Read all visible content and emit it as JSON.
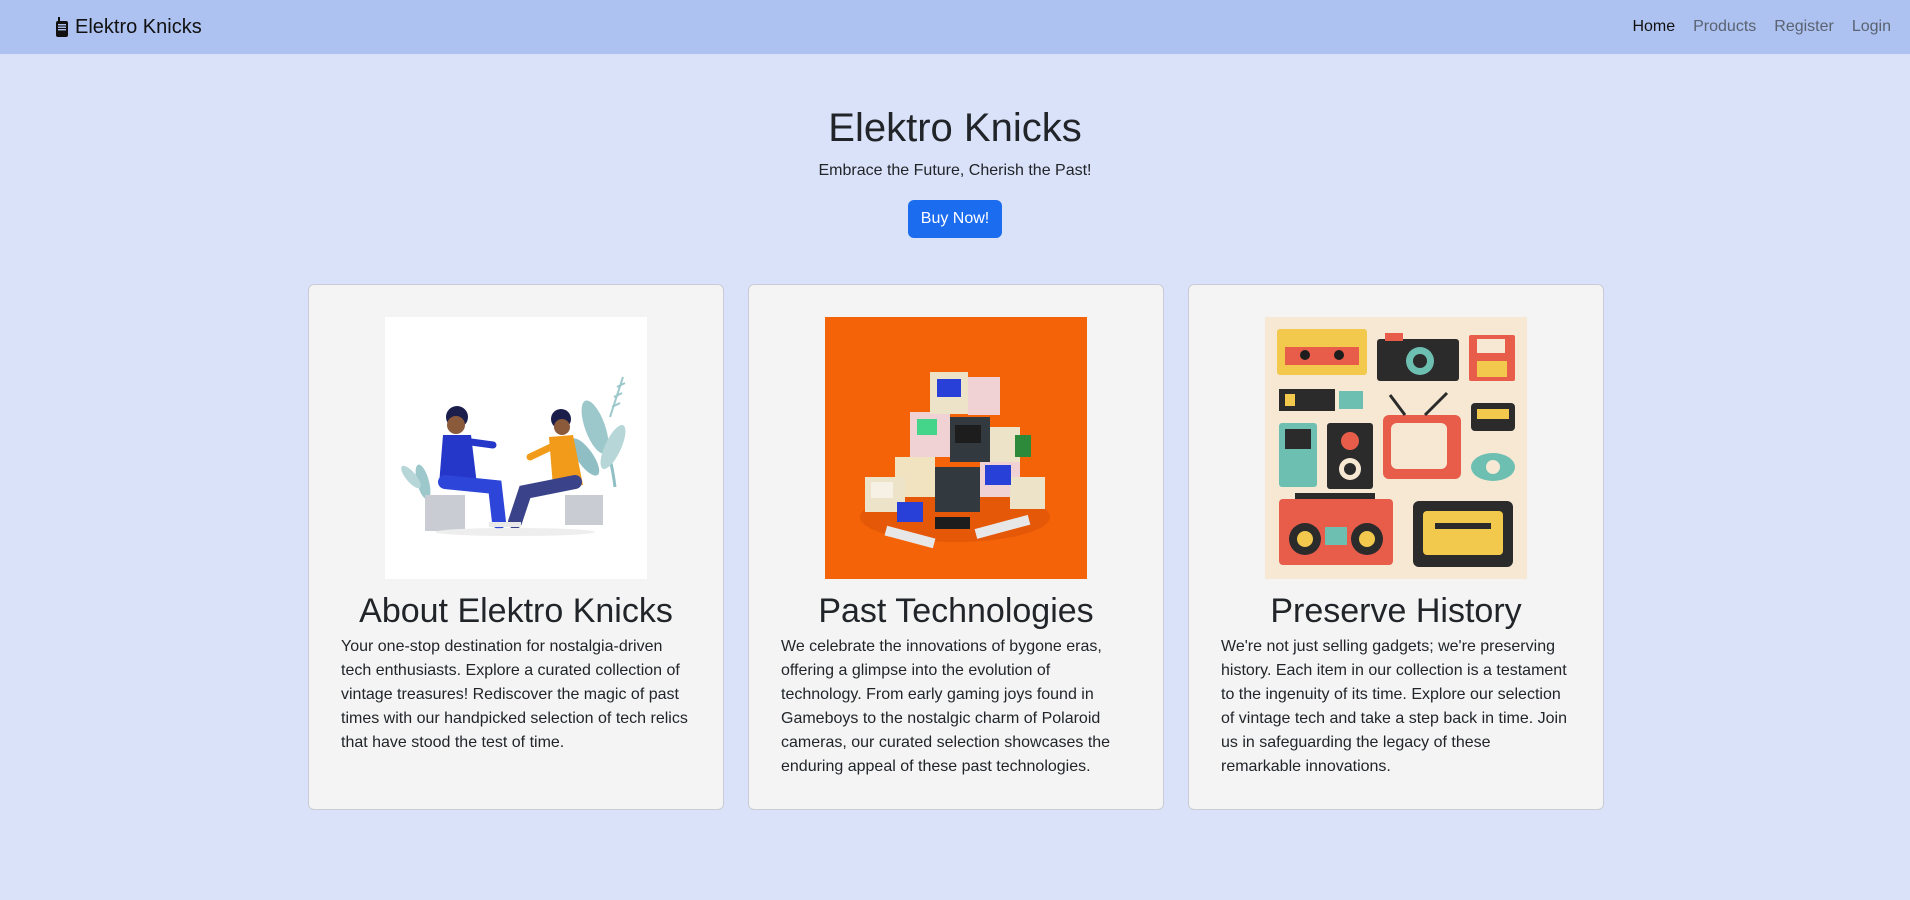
{
  "navbar": {
    "brand": "Elektro Knicks",
    "brand_icon": "walkie-talkie-icon",
    "links": [
      {
        "label": "Home",
        "active": true
      },
      {
        "label": "Products",
        "active": false
      },
      {
        "label": "Register",
        "active": false
      },
      {
        "label": "Login",
        "active": false
      }
    ]
  },
  "hero": {
    "title": "Elektro Knicks",
    "subtitle": "Embrace the Future, Cherish the Past!",
    "button_label": "Buy Now!"
  },
  "cards": [
    {
      "title": "About Elektro Knicks",
      "text": "Your one-stop destination for nostalgia-driven tech enthusiasts. Explore a curated collection of vintage treasures! Rediscover the magic of past times with our handpicked selection of tech relics that have stood the test of time.",
      "image": "two-people-talking-illustration"
    },
    {
      "title": "Past Technologies",
      "text": "We celebrate the innovations of bygone eras, offering a glimpse into the evolution of technology. From early gaming joys found in Gameboys to the nostalgic charm of Polaroid cameras, our curated selection showcases the enduring appeal of these past technologies.",
      "image": "stacked-retro-computers-illustration"
    },
    {
      "title": "Preserve History",
      "text": "We're not just selling gadgets; we're preserving history. Each item in our collection is a testament to the ingenuity of its time. Explore our selection of vintage tech and take a step back in time. Join us in safeguarding the legacy of these remarkable innovations.",
      "image": "vintage-gadgets-grid-illustration"
    }
  ],
  "colors": {
    "page_bg": "#dae2f9",
    "navbar_bg": "#adc2f0",
    "button_bg": "#1c6cf0",
    "card_bg": "#f4f4f4"
  }
}
